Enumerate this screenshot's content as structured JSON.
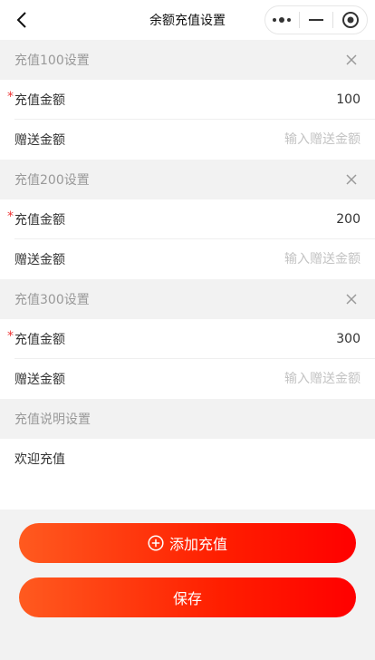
{
  "nav": {
    "title": "余额充值设置"
  },
  "sections": [
    {
      "header": "充值100设置",
      "amount_label": "充值金额",
      "amount_value": "100",
      "bonus_label": "赠送金额",
      "bonus_placeholder": "输入赠送金额"
    },
    {
      "header": "充值200设置",
      "amount_label": "充值金额",
      "amount_value": "200",
      "bonus_label": "赠送金额",
      "bonus_placeholder": "输入赠送金额"
    },
    {
      "header": "充值300设置",
      "amount_label": "充值金额",
      "amount_value": "300",
      "bonus_label": "赠送金额",
      "bonus_placeholder": "输入赠送金额"
    }
  ],
  "description": {
    "header": "充值说明设置",
    "text": "欢迎充值"
  },
  "buttons": {
    "add_label": "添加充值",
    "save_label": "保存"
  },
  "required_mark": "*",
  "colors": {
    "accent": "#ff1e00",
    "required": "#ee3333"
  },
  "icons": {
    "back": "chevron-left-icon",
    "more": "more-dots-icon",
    "minimize": "minus-icon",
    "close_app": "target-icon",
    "remove": "close-icon",
    "add": "plus-circle-icon"
  }
}
